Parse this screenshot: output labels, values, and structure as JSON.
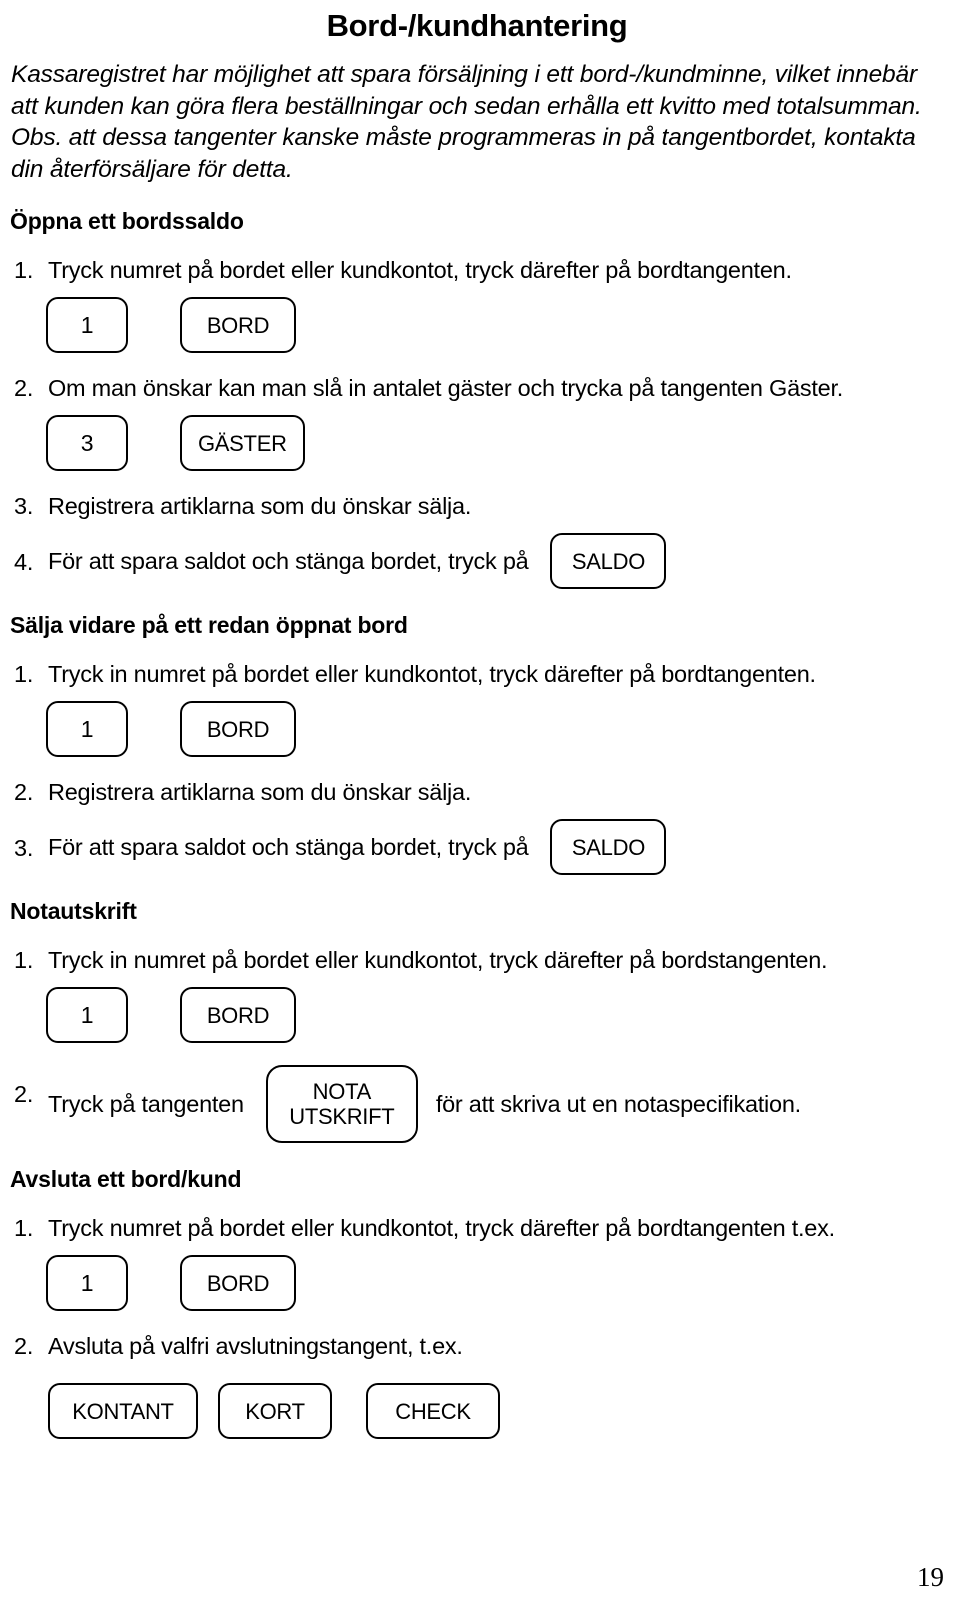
{
  "document": {
    "title": "Bord-/kundhantering",
    "page_number": "19",
    "intro_paragraph": "Kassaregistret har möjlighet att spara försäljning i ett bord-/kundminne, vilket innebär att kunden kan göra flera beställningar och sedan erhålla ett kvitto med totalsumman. Obs. att dessa tangenter kanske måste programmeras in på tangentbordet, kontakta din återförsäljare för detta."
  },
  "sections": {
    "oppna": {
      "heading": "Öppna ett bordssaldo",
      "step1_num": "1.",
      "step1_text": "Tryck numret på bordet eller kundkontot, tryck därefter på bordtangenten.",
      "step1_key_num": "1",
      "step1_key_fn": "BORD",
      "step2_num": "2.",
      "step2_text": "Om man önskar kan man slå in antalet gäster och trycka på tangenten Gäster.",
      "step2_key_num": "3",
      "step2_key_fn": "GÄSTER",
      "step3_num": "3.",
      "step3_text": "Registrera artiklarna som du önskar sälja.",
      "step4_num": "4.",
      "step4_text": "För att spara saldot och stänga bordet, tryck på",
      "step4_key": "SALDO"
    },
    "salja": {
      "heading": "Sälja vidare på ett redan öppnat bord",
      "step1_num": "1.",
      "step1_text": "Tryck in numret på bordet eller kundkontot, tryck därefter på bordtangenten.",
      "step1_key_num": "1",
      "step1_key_fn": "BORD",
      "step2_num": "2.",
      "step2_text": "Registrera artiklarna som du önskar sälja.",
      "step3_num": "3.",
      "step3_text": "För att spara saldot och stänga bordet, tryck på",
      "step3_key": "SALDO"
    },
    "nota": {
      "heading": "Notautskrift",
      "step1_num": "1.",
      "step1_text": "Tryck in numret på bordet eller kundkontot, tryck därefter på bordstangenten.",
      "step1_key_num": "1",
      "step1_key_fn": "BORD",
      "step2_num": "2.",
      "step2_text_before": "Tryck på tangenten",
      "step2_key_line1": "NOTA",
      "step2_key_line2": "UTSKRIFT",
      "step2_text_after": "för att skriva ut en notaspecifikation."
    },
    "avsluta": {
      "heading": "Avsluta ett bord/kund",
      "step1_num": "1.",
      "step1_text": "Tryck numret på bordet eller kundkontot, tryck därefter på bordtangenten t.ex.",
      "step1_key_num": "1",
      "step1_key_fn": "BORD",
      "step2_num": "2.",
      "step2_text": "Avsluta på valfri avslutningstangent, t.ex.",
      "step2_key_cash": "KONTANT",
      "step2_key_card": "KORT",
      "step2_key_check": "CHECK"
    }
  }
}
